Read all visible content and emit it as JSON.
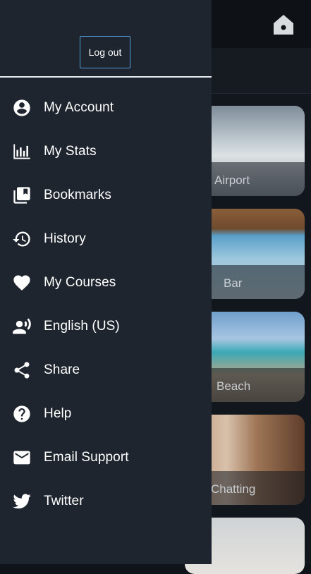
{
  "drawer": {
    "logout_label": "Log out",
    "items": [
      {
        "label": "My Account",
        "icon": "account-circle-icon"
      },
      {
        "label": "My Stats",
        "icon": "bar-chart-icon"
      },
      {
        "label": "Bookmarks",
        "icon": "bookmarks-icon"
      },
      {
        "label": "History",
        "icon": "history-icon"
      },
      {
        "label": "My Courses",
        "icon": "heart-icon"
      },
      {
        "label": "English (US)",
        "icon": "voice-speaker-icon"
      },
      {
        "label": "Share",
        "icon": "share-icon"
      },
      {
        "label": "Help",
        "icon": "help-circle-icon"
      },
      {
        "label": "Email Support",
        "icon": "envelope-icon"
      },
      {
        "label": "Twitter",
        "icon": "twitter-bird-icon"
      }
    ]
  },
  "background": {
    "home_icon": "home-icon",
    "cards": [
      {
        "label": "Airport"
      },
      {
        "label": "Bar"
      },
      {
        "label": "Beach"
      },
      {
        "label": "Chatting"
      }
    ]
  },
  "colors": {
    "drawer_bg": "#1e252e",
    "logout_border": "#4f9fd6",
    "text": "#ffffff"
  }
}
